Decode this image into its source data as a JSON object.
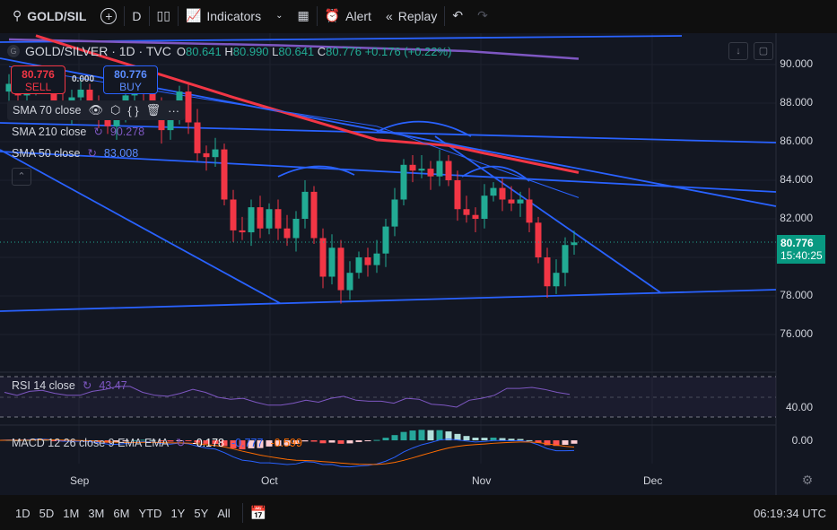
{
  "toolbar": {
    "symbol": "GOLD/SIL",
    "interval": "D",
    "indicators_label": "Indicators",
    "alert_label": "Alert",
    "replay_label": "Replay"
  },
  "legend": {
    "title": "GOLD/SILVER · 1D · TVC",
    "logo_letter": "G",
    "o_label": "O",
    "o": "80.641",
    "h_label": "H",
    "h": "80.990",
    "l_label": "L",
    "l": "80.641",
    "c_label": "C",
    "c": "80.776",
    "change": "+0.176 (+0.22%)"
  },
  "trade": {
    "sell_price": "80.776",
    "sell_label": "SELL",
    "spread": "0.000",
    "buy_price": "80.776",
    "buy_label": "BUY"
  },
  "indicators": [
    {
      "label": "SMA 70 close",
      "value": ""
    },
    {
      "label": "SMA 210 close",
      "value": "90.278"
    },
    {
      "label": "SMA 50 close",
      "value": "83.008"
    }
  ],
  "rsi": {
    "label": "RSI 14 close",
    "value": "43.47",
    "axis": "40.00"
  },
  "macd": {
    "label": "MACD 12 26 close 9 EMA EMA",
    "hist": "-0.178",
    "macd": "-0.777",
    "signal": "-0.599",
    "axis": "0.00"
  },
  "price_tag": {
    "price": "80.776",
    "countdown": "15:40:25"
  },
  "bottom": {
    "ranges": [
      "1D",
      "5D",
      "1M",
      "3M",
      "6M",
      "YTD",
      "1Y",
      "5Y",
      "All"
    ],
    "time": "06:19:34 UTC"
  },
  "colors": {
    "up": "#22ab94",
    "down": "#f23645",
    "sma70": "#f23645",
    "sma210": "#7e57c2",
    "sma50": "#2962ff",
    "trend": "#2962ff",
    "rsi": "#7e57c2"
  },
  "chart_data": {
    "type": "candlestick",
    "title": "GOLD/SILVER · 1D · TVC",
    "y_ticks": [
      "90.000",
      "88.000",
      "86.000",
      "84.000",
      "82.000",
      "80.000",
      "78.000",
      "76.000"
    ],
    "x_ticks": [
      "Sep",
      "Oct",
      "Nov",
      "Dec"
    ],
    "ylim": [
      75,
      92
    ],
    "closes": [
      88.6,
      89.0,
      88.4,
      88.9,
      89.4,
      88.8,
      88.1,
      87.6,
      88.3,
      88.7,
      87.9,
      87.3,
      86.8,
      87.5,
      88.4,
      89.0,
      88.5,
      87.9,
      86.6,
      87.2,
      88.6,
      87.0,
      85.4,
      85.2,
      85.6,
      83.0,
      81.4,
      81.3,
      82.6,
      81.5,
      82.5,
      81.5,
      81.0,
      82.0,
      83.4,
      81.0,
      79.0,
      80.5,
      78.3,
      79.2,
      80.0,
      79.6,
      80.2,
      81.6,
      83.0,
      84.8,
      84.5,
      84.6,
      84.2,
      85.0,
      84.0,
      82.5,
      82.2,
      82.0,
      83.2,
      83.6,
      83.0,
      82.8,
      83.0,
      81.8,
      80.0,
      78.5,
      79.2,
      80.64,
      80.776
    ],
    "sma70": [
      [
        3,
        91.5
      ],
      [
        25,
        88.3
      ],
      [
        41,
        86.1
      ],
      [
        49,
        85.8
      ],
      [
        53,
        85.4
      ],
      [
        63.5,
        84.4
      ]
    ],
    "sma210": [
      [
        0,
        91.3
      ],
      [
        30,
        91.0
      ],
      [
        51,
        90.7
      ],
      [
        63.5,
        90.3
      ]
    ],
    "sma50": [
      [
        0,
        89.9
      ],
      [
        22,
        88.2
      ],
      [
        41,
        86.8
      ],
      [
        55,
        84.5
      ],
      [
        63.5,
        83.1
      ]
    ],
    "rsi_values": [
      55,
      52,
      56,
      57,
      54,
      52,
      52,
      56,
      58,
      61,
      61,
      55,
      52,
      51,
      54,
      58,
      55,
      50,
      48,
      49,
      45,
      42,
      42,
      44,
      47,
      45,
      49,
      51,
      47,
      46,
      46,
      44,
      49,
      48,
      43,
      42,
      40,
      47,
      49,
      52,
      59,
      59,
      60,
      58,
      55,
      53
    ]
  }
}
